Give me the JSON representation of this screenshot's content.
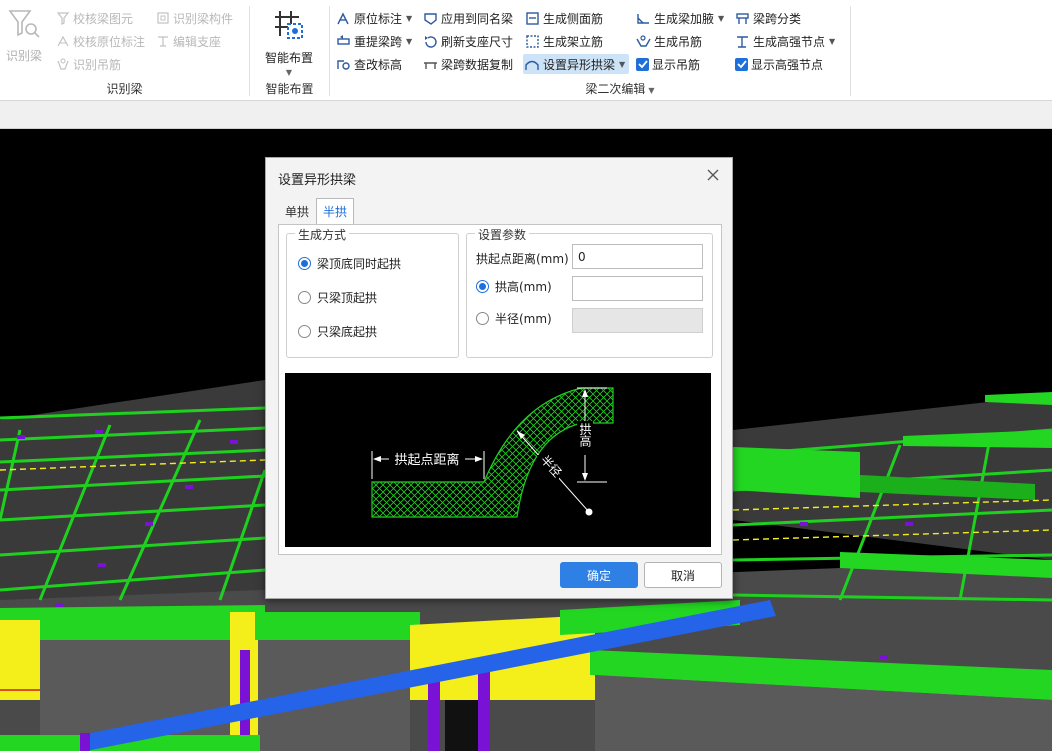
{
  "ribbon": {
    "group1": {
      "big_label": "识别梁",
      "items": [
        "校核梁图元",
        "校核原位标注",
        "识别吊筋",
        "识别梁构件",
        "编辑支座"
      ],
      "label": "识别梁"
    },
    "group2": {
      "big_label": "智能布置",
      "label": "智能布置"
    },
    "group3": {
      "col1": [
        "原位标注",
        "重提梁跨",
        "查改标高"
      ],
      "col2": [
        "应用到同名梁",
        "刷新支座尺寸",
        "梁跨数据复制"
      ],
      "col3": [
        "生成侧面筋",
        "生成架立筋",
        "设置异形拱梁"
      ],
      "col4": [
        "生成梁加腋",
        "生成吊筋",
        "显示吊筋"
      ],
      "col5": [
        "梁跨分类",
        "生成高强节点",
        "显示高强节点"
      ],
      "label": "梁二次编辑"
    }
  },
  "dialog": {
    "title": "设置异形拱梁",
    "tabs": [
      "单拱",
      "半拱"
    ],
    "active_tab": "半拱",
    "generation": {
      "legend": "生成方式",
      "options": [
        "梁顶底同时起拱",
        "只梁顶起拱",
        "只梁底起拱"
      ],
      "selected": "梁顶底同时起拱"
    },
    "params": {
      "legend": "设置参数",
      "start_distance_label": "拱起点距离(mm)",
      "start_distance_value": "0",
      "height_label": "拱高(mm)",
      "height_value": "",
      "radius_label": "半径(mm)",
      "radius_value": "",
      "selected": "拱高(mm)"
    },
    "diagram": {
      "start_distance": "拱起点距离",
      "height": "拱高",
      "radius": "半径"
    },
    "ok": "确定",
    "cancel": "取消"
  },
  "colors": {
    "accent": "#2f80e4",
    "beam_green": "#1fd11f",
    "beam_yellow": "#f4ee1a",
    "beam_blue": "#2563e8",
    "support_purple": "#7a12d6"
  }
}
